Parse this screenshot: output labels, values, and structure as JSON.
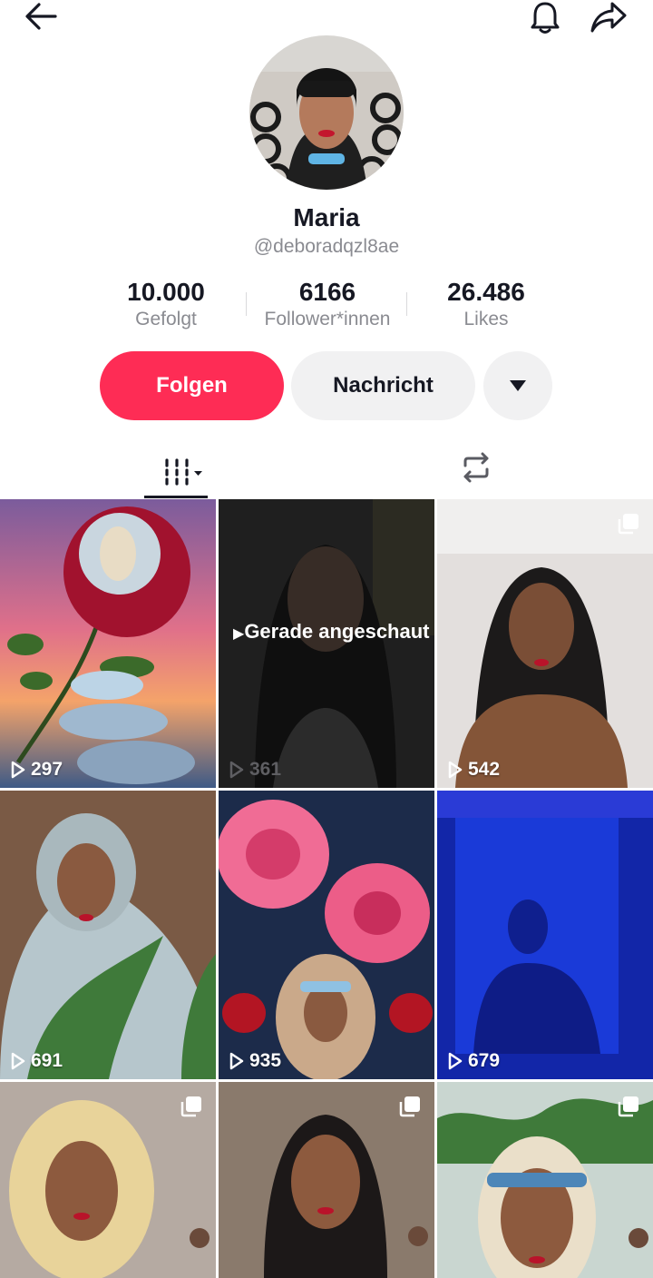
{
  "profile": {
    "name": "Maria",
    "handle": "@deboradqzl8ae"
  },
  "stats": {
    "following": {
      "value": "10.000",
      "label": "Gefolgt"
    },
    "followers": {
      "value": "6166",
      "label": "Follower*innen"
    },
    "likes": {
      "value": "26.486",
      "label": "Likes"
    }
  },
  "actions": {
    "follow_label": "Folgen",
    "message_label": "Nachricht"
  },
  "icons": {
    "back": "arrow-left-icon",
    "bell": "bell-icon",
    "share": "share-icon",
    "videos_tab": "grid-icon",
    "reposts_tab": "repost-icon"
  },
  "colors": {
    "accent": "#fe2c55",
    "button_secondary": "#f1f1f2"
  },
  "videos": [
    {
      "views": "297"
    },
    {
      "views": "361",
      "overlay": "Gerade angeschaut"
    },
    {
      "views": "542"
    },
    {
      "views": "691"
    },
    {
      "views": "935"
    },
    {
      "views": "679"
    },
    {
      "views": ""
    },
    {
      "views": ""
    },
    {
      "views": ""
    }
  ]
}
